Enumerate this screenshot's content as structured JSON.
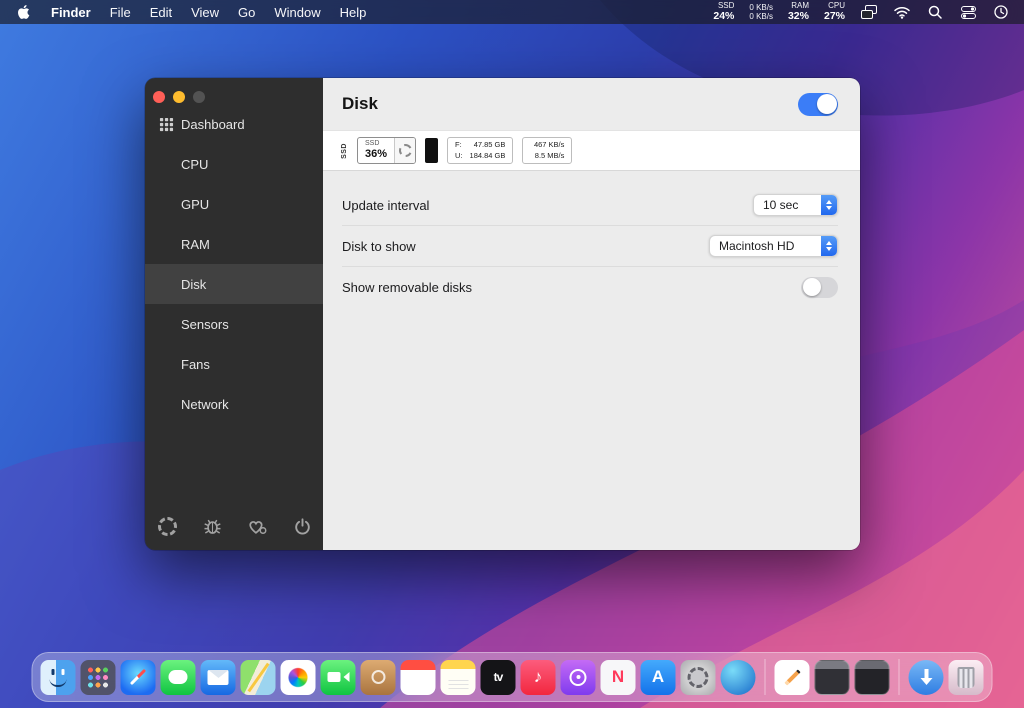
{
  "menubar": {
    "app_name": "Finder",
    "menus": [
      "File",
      "Edit",
      "View",
      "Go",
      "Window",
      "Help"
    ],
    "status": [
      {
        "top": "SSD",
        "bottom": "24%"
      },
      {
        "top": "0 KB/s",
        "bottom": "0 KB/s"
      },
      {
        "top": "RAM",
        "bottom": "32%"
      },
      {
        "top": "CPU",
        "bottom": "27%"
      }
    ],
    "icons": [
      "mission-control-icon",
      "wifi-icon",
      "search-icon",
      "control-center-icon",
      "clock-icon"
    ]
  },
  "window": {
    "title": "Disk",
    "module_enabled": true,
    "sidebar": {
      "items": [
        "Dashboard",
        "CPU",
        "GPU",
        "RAM",
        "Disk",
        "Sensors",
        "Fans",
        "Network"
      ],
      "selected": "Disk",
      "footer_icons": [
        "settings-gear-icon",
        "bug-icon",
        "support-heart-icon",
        "power-icon"
      ]
    },
    "widgets": {
      "mini_label": "SSD",
      "percent": {
        "label": "SSD",
        "value": "36%"
      },
      "usage": {
        "free_label": "F:",
        "free_value": "47.85 GB",
        "used_label": "U:",
        "used_value": "184.84 GB"
      },
      "speed": {
        "read": "467 KB/s",
        "write": "8.5 MB/s"
      }
    },
    "settings": {
      "update_interval": {
        "label": "Update interval",
        "value": "10 sec"
      },
      "disk_to_show": {
        "label": "Disk to show",
        "value": "Macintosh HD"
      },
      "show_removable": {
        "label": "Show removable disks",
        "enabled": false
      }
    }
  },
  "dock": {
    "icons": [
      "finder",
      "launchpad",
      "safari",
      "messages",
      "mail",
      "maps",
      "photos",
      "facetime",
      "contacts",
      "calendar",
      "notes",
      "tv",
      "music",
      "podcasts",
      "news",
      "app-store",
      "system-preferences",
      "stats",
      "separator",
      "pages",
      "window-1",
      "window-2",
      "separator",
      "downloads",
      "trash"
    ]
  },
  "colors": {
    "accent": "#3b7df7",
    "sidebar_bg": "#2e2e2e",
    "content_bg": "#ececec",
    "toggle_on": "#3b7df7"
  }
}
